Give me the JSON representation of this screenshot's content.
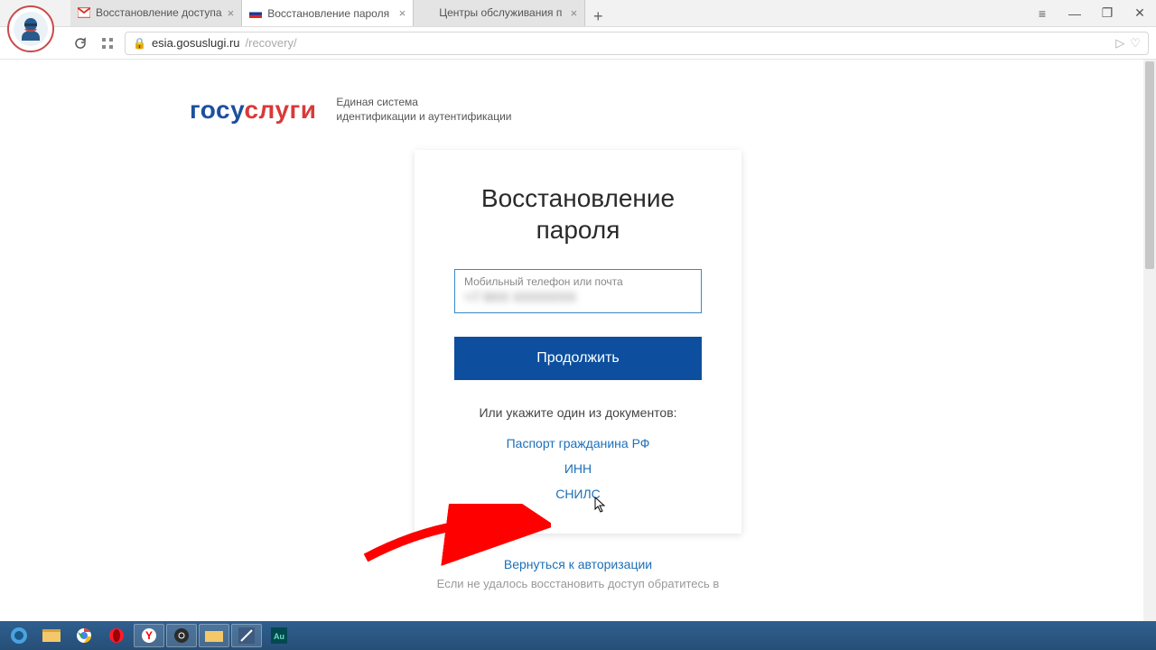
{
  "browser": {
    "tabs": [
      {
        "title": "Восстановление доступа",
        "favicon": "gmail"
      },
      {
        "title": "Восстановление пароля",
        "favicon": "ru",
        "active": true
      },
      {
        "title": "Центры обслуживания п",
        "favicon": "blank"
      }
    ],
    "newtab": "+",
    "url_host": "esia.gosuslugi.ru",
    "url_path": "/recovery/",
    "win": {
      "menu": "≡",
      "min": "—",
      "max": "❐",
      "close": "✕"
    }
  },
  "page": {
    "logo": {
      "p1": "госу",
      "p2": "слуги"
    },
    "logo_sub_line1": "Единая система",
    "logo_sub_line2": "идентификации и аутентификации",
    "title": "Восстановление пароля",
    "input_label": "Мобильный телефон или почта",
    "input_value_masked": "+7 9XX XXXXXXX",
    "button": "Продолжить",
    "alt_prompt": "Или укажите один из документов:",
    "links": {
      "passport": "Паспорт гражданина РФ",
      "inn": "ИНН",
      "snils": "СНИЛС"
    },
    "back": "Вернуться к авторизации",
    "footer_cut": "Если не удалось восстановить доступ обратитесь в"
  },
  "taskbar": {
    "items": [
      "start",
      "files",
      "chrome",
      "opera",
      "yandex",
      "obs",
      "folder",
      "editor",
      "audition"
    ]
  }
}
